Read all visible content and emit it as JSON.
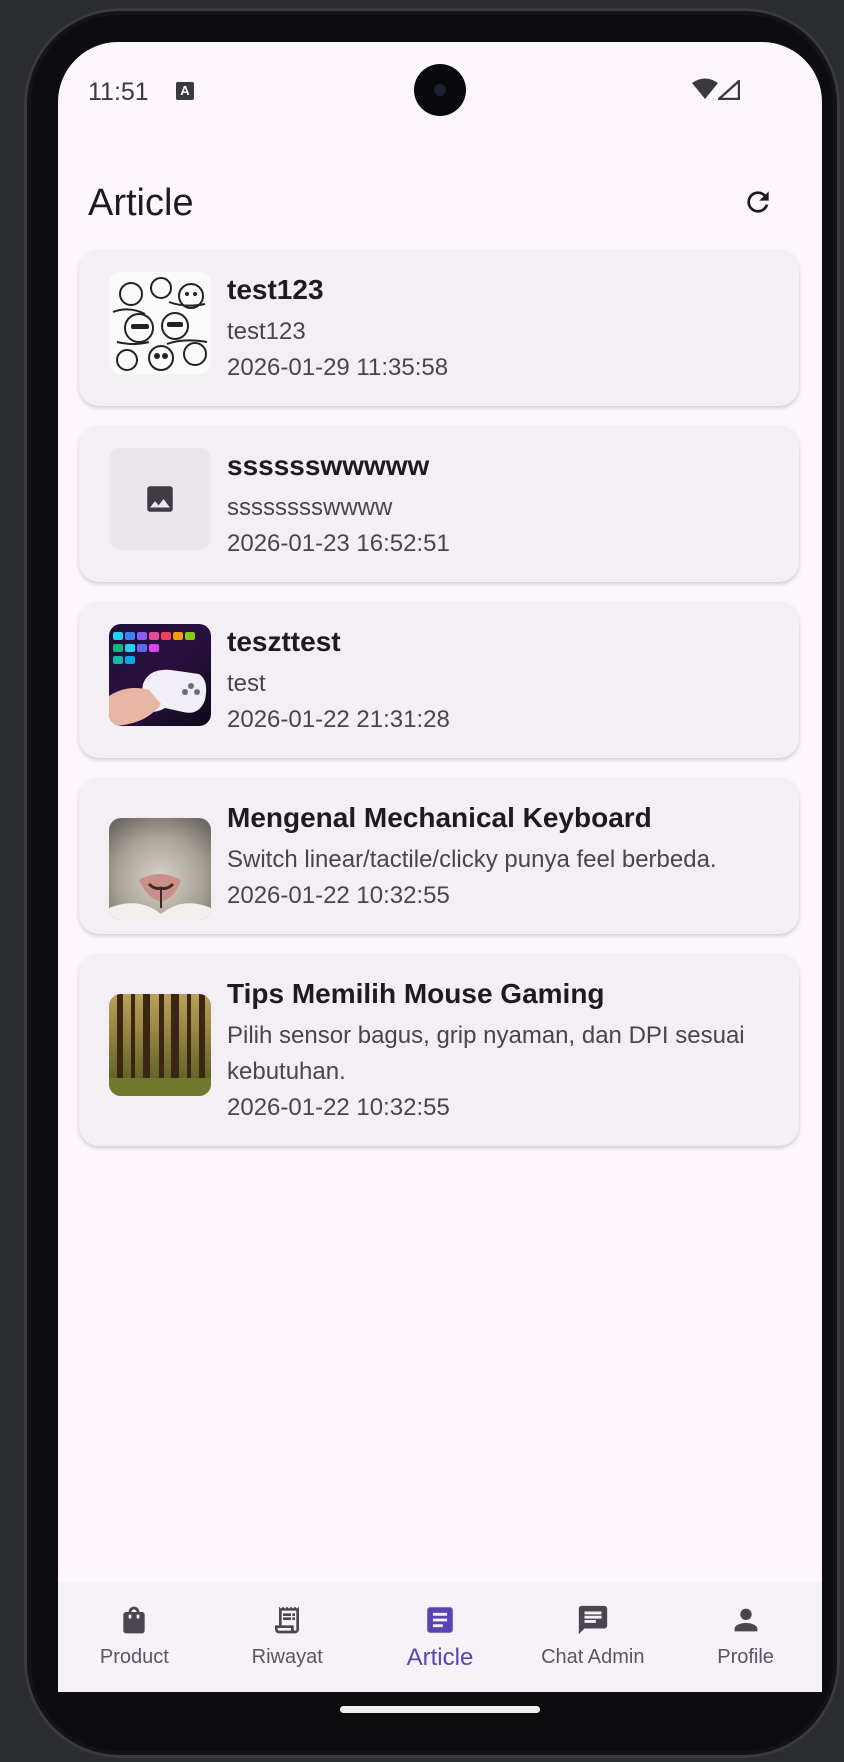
{
  "status_bar": {
    "time": "11:51",
    "notification_icon": "A"
  },
  "app_bar": {
    "title": "Article",
    "refresh_icon": "refresh-icon"
  },
  "articles": [
    {
      "title": "test123",
      "description": "test123",
      "date": "2026-01-29 11:35:58",
      "thumbnail": "cartoon-doodle-image"
    },
    {
      "title": "sssssswwwww",
      "description": "sssssssswwww",
      "date": "2026-01-23 16:52:51",
      "thumbnail": "image-placeholder-icon"
    },
    {
      "title": "teszttest",
      "description": "test",
      "date": "2026-01-22 21:31:28",
      "thumbnail": "gaming-keyboard-controller-image"
    },
    {
      "title": "Mengenal Mechanical Keyboard",
      "description": "Switch linear/tactile/clicky punya feel berbeda.",
      "date": "2026-01-22 10:32:55",
      "thumbnail": "cat-nose-image"
    },
    {
      "title": "Tips Memilih Mouse Gaming",
      "description": "Pilih sensor bagus, grip nyaman, dan DPI sesuai kebutuhan.",
      "date": "2026-01-22 10:32:55",
      "thumbnail": "forest-image"
    }
  ],
  "bottom_nav": [
    {
      "label": "Product",
      "icon": "shopping-bag-icon",
      "active": false
    },
    {
      "label": "Riwayat",
      "icon": "receipt-icon",
      "active": false
    },
    {
      "label": "Article",
      "icon": "article-icon",
      "active": true
    },
    {
      "label": "Chat Admin",
      "icon": "chat-icon",
      "active": false
    },
    {
      "label": "Profile",
      "icon": "person-icon",
      "active": false
    }
  ],
  "colors": {
    "background": "#fdf7fd",
    "card": "#f4eff5",
    "accent": "#5b45b0",
    "text_primary": "#1d1b20",
    "text_secondary": "#49454f"
  }
}
